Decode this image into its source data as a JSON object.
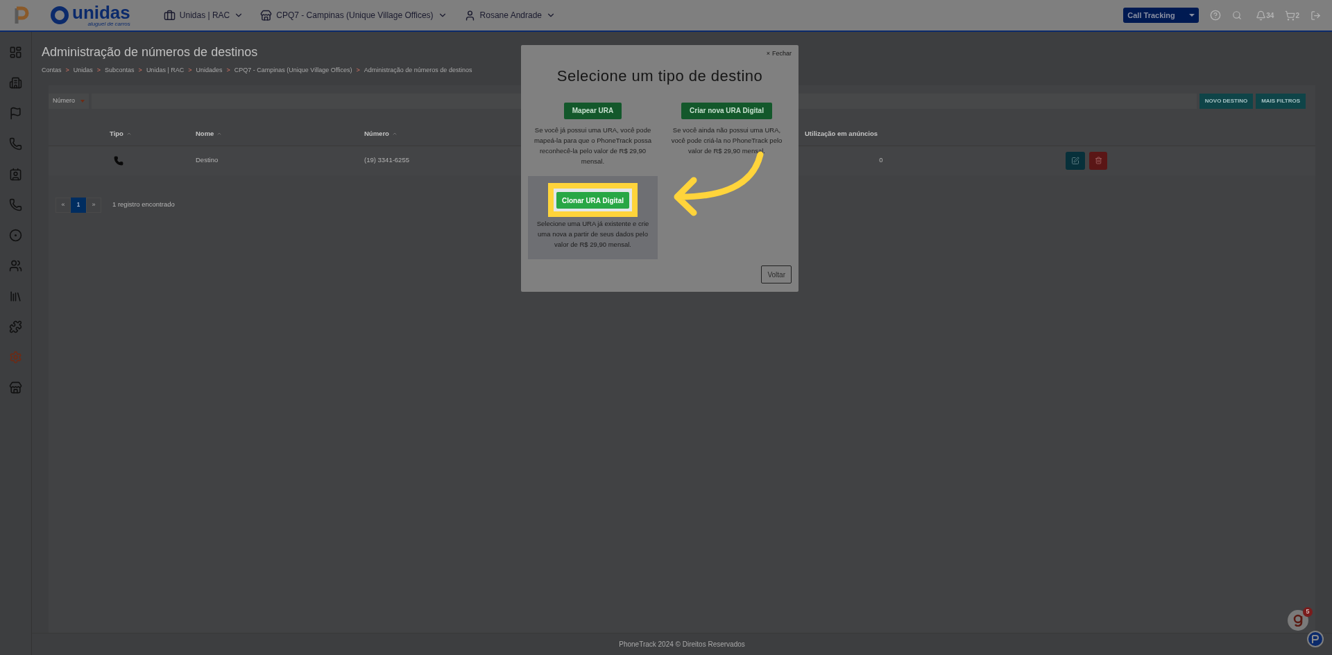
{
  "topbar": {
    "brand": "unidas",
    "tagline": "aluguel de carros",
    "account": "Unidas | RAC",
    "unit": "CPQ7 - Campinas (Unique Village Offices)",
    "user": "Rosane Andrade",
    "product": "Call Tracking",
    "notifications": "34",
    "cart": "2"
  },
  "sidebar": [
    {
      "kind": "dashboard",
      "selected": false
    },
    {
      "kind": "building",
      "selected": false
    },
    {
      "kind": "flag",
      "selected": false
    },
    {
      "kind": "phone",
      "selected": false
    },
    {
      "kind": "contact",
      "selected": false
    },
    {
      "kind": "phone",
      "selected": false
    },
    {
      "kind": "target",
      "selected": false
    },
    {
      "kind": "users",
      "selected": false
    },
    {
      "kind": "library",
      "selected": false
    },
    {
      "kind": "puzzle",
      "selected": false
    },
    {
      "kind": "settings",
      "selected": true
    },
    {
      "kind": "store",
      "selected": false
    }
  ],
  "page": {
    "title": "Administração de números de destinos",
    "breadcrumb": [
      "Contas",
      "Unidas",
      "Subcontas",
      "Unidas | RAC",
      "Unidades",
      "CPQ7 - Campinas (Unique Village Offices)",
      "Administração de números de destinos"
    ]
  },
  "breadcrumb_separator": ">",
  "filter": {
    "field": "Número"
  },
  "actions": [
    "NOVO DESTINO",
    "MAIS FILTROS"
  ],
  "table": {
    "columns": [
      {
        "label": "Tipo",
        "sortable": true
      },
      {
        "label": "Nome",
        "sortable": true
      },
      {
        "label": "Número",
        "sortable": true
      },
      {
        "label": "Utilização em anúncios",
        "sortable": false
      }
    ],
    "rows": [
      {
        "nome": "Destino",
        "numero": "(19) 3341-6255",
        "utilizacao": "0"
      }
    ]
  },
  "pagination": {
    "prev": "«",
    "pages": [
      {
        "label": "1",
        "selected": true
      }
    ],
    "next": "»",
    "count": "1 registro encontrado"
  },
  "footer": "PhoneTrack 2024 © Direitos Reservados",
  "modal": {
    "close_icon": "×",
    "close": "Fechar",
    "title": "Selecione um tipo de destino",
    "options": [
      {
        "button": "Mapear URA",
        "description": "Se você já possui uma URA, você pode mapeá-la para que o PhoneTrack possa reconhecê-la pelo valor de R$ 29,90 mensal.",
        "highlighted": false
      },
      {
        "button": "Criar nova URA Digital",
        "description": "Se você ainda não possui uma URA, você pode criá-la no PhoneTrack pelo valor de R$ 29,90 mensal.",
        "highlighted": false
      },
      {
        "button": "Clonar URA Digital",
        "description": "Selecione uma URA já existente e crie uma nova a partir de seus dados pelo valor de R$ 29,90 mensal.",
        "highlighted": true
      }
    ],
    "back": "Voltar"
  },
  "help_badge": "5"
}
